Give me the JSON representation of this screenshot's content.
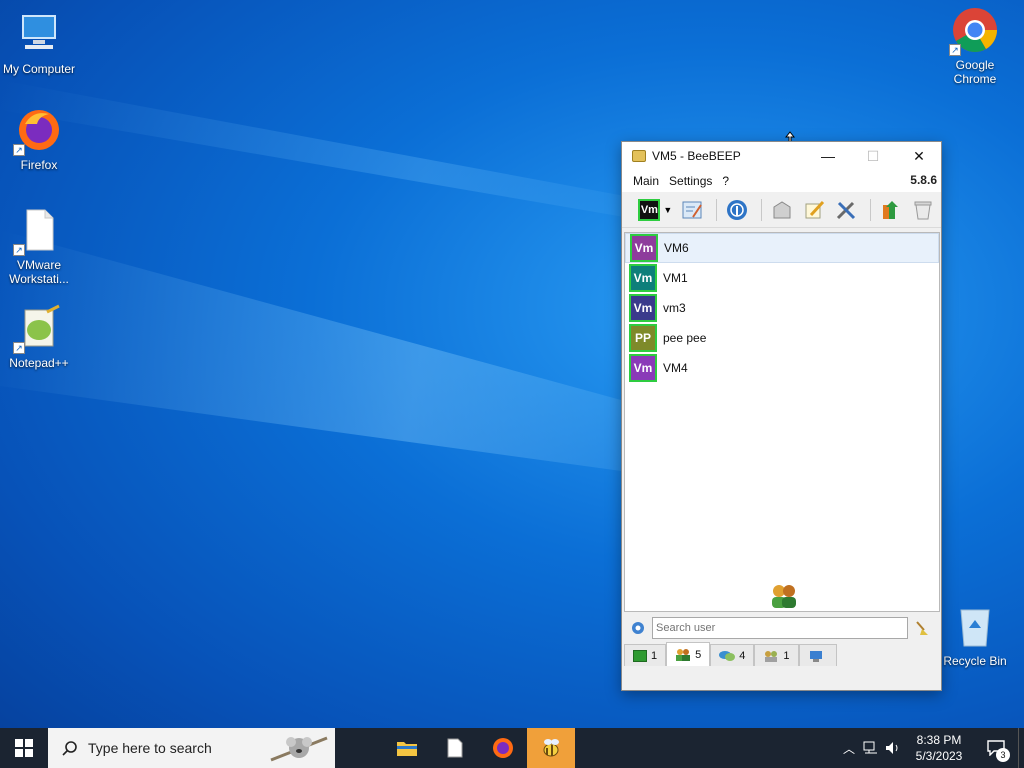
{
  "desktop": {
    "icons": [
      {
        "label": "My Computer"
      },
      {
        "label": "Firefox"
      },
      {
        "label": "VMware Workstati..."
      },
      {
        "label": "Notepad++"
      },
      {
        "label": "Google Chrome"
      },
      {
        "label": "Recycle Bin"
      }
    ]
  },
  "window": {
    "title": "VM5 - BeeBEEP",
    "menu": [
      "Main",
      "Settings",
      "?"
    ],
    "version": "5.8.6",
    "toolbar_status_avatar": "Vm",
    "users": [
      {
        "initials": "Vm",
        "name": "VM6",
        "color": "#8e3c9c",
        "selected": true
      },
      {
        "initials": "Vm",
        "name": "VM1",
        "color": "#0e7f7a",
        "selected": false
      },
      {
        "initials": "Vm",
        "name": "vm3",
        "color": "#3a3a8c",
        "selected": false
      },
      {
        "initials": "PP",
        "name": "pee pee",
        "color": "#7e8a2a",
        "selected": false
      },
      {
        "initials": "Vm",
        "name": "VM4",
        "color": "#8a3ab8",
        "selected": false
      }
    ],
    "search": {
      "placeholder": "Search user"
    },
    "tabs": [
      {
        "icon": "chat-green-icon",
        "count": "1"
      },
      {
        "icon": "users-icon",
        "count": "5"
      },
      {
        "icon": "chats-icon",
        "count": "4"
      },
      {
        "icon": "groups-icon",
        "count": "1"
      },
      {
        "icon": "network-icon",
        "count": ""
      }
    ]
  },
  "taskbar": {
    "search_placeholder": "Type here to search",
    "time": "8:38 PM",
    "date": "5/3/2023",
    "notifications": "3"
  },
  "colors": {
    "accent_active_app": "#f0a03a",
    "online_border": "#2ecc40"
  }
}
